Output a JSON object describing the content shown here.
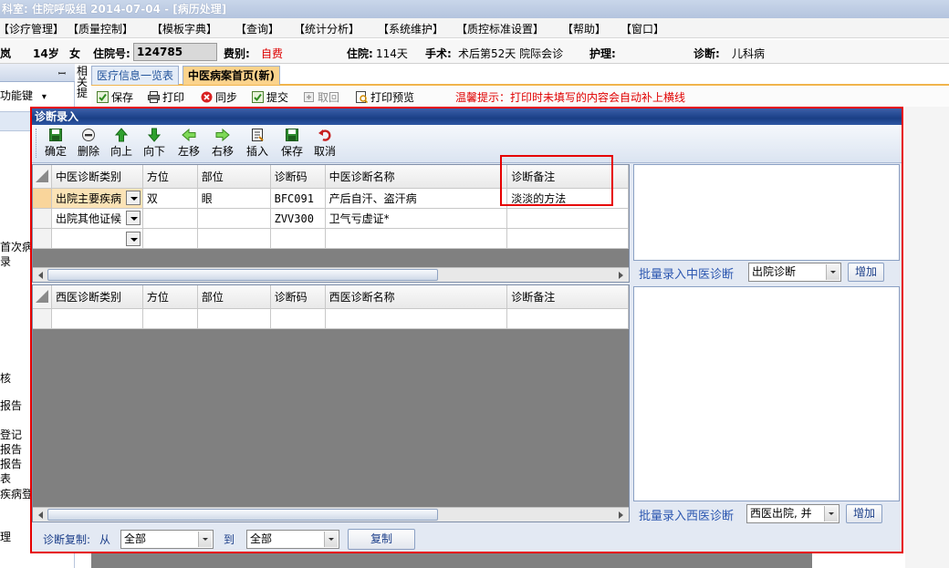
{
  "window": {
    "title": "科室: 住院呼吸组   2014-07-04 - [病历处理]"
  },
  "menu": [
    "【诊疗管理】",
    "【质量控制】",
    "【模板字典】",
    "【查询】",
    "【统计分析】",
    "【系统维护】",
    "【质控标准设置】",
    "【帮助】",
    "【窗口】"
  ],
  "patient": {
    "name_fragment": "岚",
    "age": "14岁",
    "sex": "女",
    "admission_no_label": "住院号:",
    "admission_no": "124785",
    "fee_type_label": "费别:",
    "fee_type": "自费",
    "stay_label": "住院:",
    "stay": "114天",
    "surgery_label": "手术:",
    "surgery": "术后第52天 院际会诊",
    "nursing_label": "护理:",
    "nursing": "",
    "diagnosis_label": "诊断:",
    "diagnosis": "儿科病"
  },
  "left_panel": {
    "pin": "ꟷ",
    "func_key": "功能键",
    "func_arrow": "▾",
    "items": [
      "首次病",
      "录",
      "",
      "",
      "核",
      "",
      "报告",
      "",
      "登记",
      "报告",
      "报告",
      "表",
      "疾病登",
      "",
      "理"
    ]
  },
  "side_strip_text": "相关提",
  "tabs": {
    "inactive": "医疗信息一览表",
    "active": "中医病案首页(新)"
  },
  "actions": {
    "save": "保存",
    "print": "打印",
    "sync": "同步",
    "submit": "提交",
    "retrieve": "取回",
    "print_preview": "打印预览",
    "warning": "温馨提示：打印时未填写的内容会自动补上横线"
  },
  "dialog": {
    "title": "诊断录入",
    "toolbar": [
      "确定",
      "删除",
      "向上",
      "向下",
      "左移",
      "右移",
      "插入",
      "保存",
      "取消"
    ],
    "tcm_grid": {
      "headers": [
        "中医诊断类别",
        "方位",
        "部位",
        "诊断码",
        "中医诊断名称",
        "诊断备注"
      ],
      "rows": [
        {
          "category": "出院主要疾病",
          "position": "双",
          "site": "眼",
          "code": "BFC091",
          "name": "产后自汗、盗汗病",
          "remark": "淡淡的方法"
        },
        {
          "category": "出院其他证候",
          "position": "",
          "site": "",
          "code": "ZVV300",
          "name": "卫气亏虚证*",
          "remark": ""
        },
        {
          "category": "",
          "position": "",
          "site": "",
          "code": "",
          "name": "",
          "remark": ""
        }
      ]
    },
    "western_grid": {
      "headers": [
        "西医诊断类别",
        "方位",
        "部位",
        "诊断码",
        "西医诊断名称",
        "诊断备注"
      ],
      "rows": [
        {
          "category": "",
          "position": "",
          "site": "",
          "code": "",
          "name": "",
          "remark": ""
        }
      ]
    },
    "batch_tcm": {
      "label": "批量录入中医诊断",
      "value": "出院诊断",
      "button": "增加"
    },
    "batch_western": {
      "label": "批量录入西医诊断",
      "value": "西医出院, 并",
      "button": "增加"
    },
    "copy": {
      "label": "诊断复制:",
      "from_label": "从",
      "from_value": "全部",
      "to_label": "到",
      "to_value": "全部",
      "button": "复制"
    }
  },
  "colors": {
    "dialog_border": "#e60000",
    "title_bar": "#1a3f86",
    "active_tab": "#fbd38c",
    "warning": "#e00000"
  }
}
